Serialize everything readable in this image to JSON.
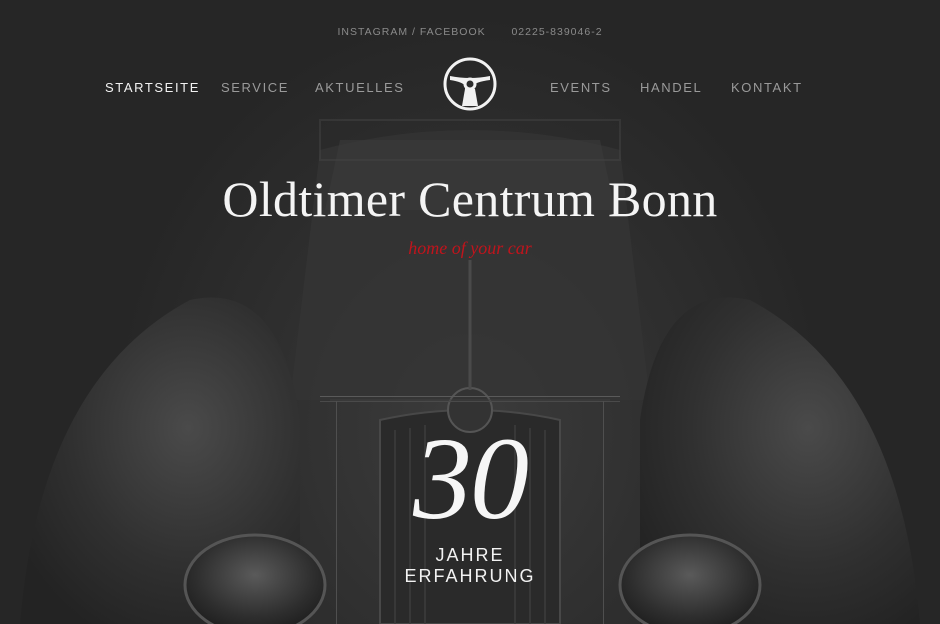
{
  "topbar": {
    "social": "INSTAGRAM / FACEBOOK",
    "phone": "02225-839046-2"
  },
  "nav": {
    "items": [
      {
        "label": "STARTSEITE",
        "active": true
      },
      {
        "label": "SERVICE",
        "active": false
      },
      {
        "label": "AKTUELLES",
        "active": false
      },
      {
        "label": "EVENTS",
        "active": false
      },
      {
        "label": "HANDEL",
        "active": false
      },
      {
        "label": "KONTAKT",
        "active": false
      }
    ],
    "logo_icon": "steering-wheel-icon"
  },
  "hero": {
    "title": "Oldtimer Centrum Bonn",
    "subtitle": "home of your car",
    "subtitle_color": "#c0141c"
  },
  "badge": {
    "number": "30",
    "line1": "JAHRE",
    "line2": "ERFAHRUNG"
  }
}
